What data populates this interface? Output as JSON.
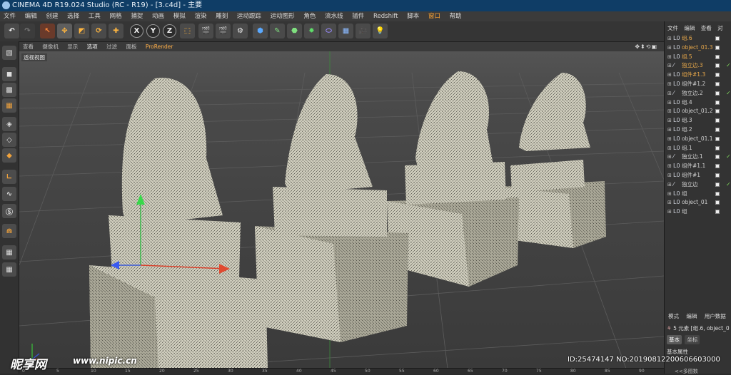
{
  "window": {
    "title": "CINEMA 4D R19.024 Studio (RC - R19) - [3.c4d] - 主要"
  },
  "menu": [
    "文件",
    "编辑",
    "创建",
    "选择",
    "工具",
    "网格",
    "捕捉",
    "动画",
    "模拟",
    "渲染",
    "雕刻",
    "运动跟踪",
    "运动图形",
    "角色",
    "流水线",
    "插件",
    "Redshift",
    "脚本",
    "窗口",
    "帮助"
  ],
  "toolbar": {
    "x": "X",
    "y": "Y",
    "z": "Z"
  },
  "viewport": {
    "menu": [
      "查看",
      "摄像机",
      "显示",
      "选项",
      "过滤",
      "面板",
      "ProRender"
    ],
    "active_menu": "选项",
    "label": "透视视图",
    "nav_icons": "✥⬍⟲▣"
  },
  "object_manager": {
    "tabs": [
      "文件",
      "编辑",
      "查看",
      "对"
    ],
    "items": [
      {
        "name": "组.6",
        "icon": "L0",
        "color": "#e8a84a",
        "tag": ""
      },
      {
        "name": "object_01.3",
        "icon": "L0",
        "color": "#e8a84a",
        "tag": ""
      },
      {
        "name": "组.5",
        "icon": "L0",
        "color": "#e8a84a",
        "tag": ""
      },
      {
        "name": "独立边.3",
        "icon": "⁄",
        "color": "#e8a84a",
        "tag": "✓"
      },
      {
        "name": "组件#1.3",
        "icon": "L0",
        "color": "#e8a84a",
        "tag": ""
      },
      {
        "name": "组件#1.2",
        "icon": "L0",
        "color": "#d0d0d0",
        "tag": ""
      },
      {
        "name": "独立边.2",
        "icon": "⁄",
        "color": "#d0d0d0",
        "tag": "✓"
      },
      {
        "name": "组.4",
        "icon": "L0",
        "color": "#d0d0d0",
        "tag": ""
      },
      {
        "name": "object_01.2",
        "icon": "L0",
        "color": "#d0d0d0",
        "tag": ""
      },
      {
        "name": "组.3",
        "icon": "L0",
        "color": "#d0d0d0",
        "tag": ""
      },
      {
        "name": "组.2",
        "icon": "L0",
        "color": "#d0d0d0",
        "tag": ""
      },
      {
        "name": "object_01.1",
        "icon": "L0",
        "color": "#d0d0d0",
        "tag": ""
      },
      {
        "name": "组.1",
        "icon": "L0",
        "color": "#d0d0d0",
        "tag": ""
      },
      {
        "name": "独立边.1",
        "icon": "⁄",
        "color": "#d0d0d0",
        "tag": "✓"
      },
      {
        "name": "组件#1.1",
        "icon": "L0",
        "color": "#d0d0d0",
        "tag": ""
      },
      {
        "name": "组件#1",
        "icon": "L0",
        "color": "#d0d0d0",
        "tag": ""
      },
      {
        "name": "独立边",
        "icon": "⁄",
        "color": "#d0d0d0",
        "tag": "✓"
      },
      {
        "name": "组",
        "icon": "L0",
        "color": "#d0d0d0",
        "tag": ""
      },
      {
        "name": "object_01",
        "icon": "L0",
        "color": "#d0d0d0",
        "tag": ""
      },
      {
        "name": "组",
        "icon": "L0",
        "color": "#d0d0d0",
        "tag": ""
      }
    ]
  },
  "attributes": {
    "tabs": [
      "模式",
      "编辑",
      "用户数据"
    ],
    "selection": "5 元素 [组.6, object_0",
    "btn_basic": "基本",
    "btn_coord": "坐标",
    "section": "基本属性",
    "footer": "<<多图数"
  },
  "timeline": {
    "ticks": [
      "0",
      "5",
      "10",
      "15",
      "20",
      "25",
      "30",
      "35",
      "40",
      "45",
      "50",
      "55",
      "60",
      "65",
      "70",
      "75",
      "80",
      "85",
      "90"
    ]
  },
  "watermark": {
    "brand": "昵享网",
    "url": "www.nipic.cn",
    "id": "ID:25474147 NO:20190812200606603000"
  }
}
